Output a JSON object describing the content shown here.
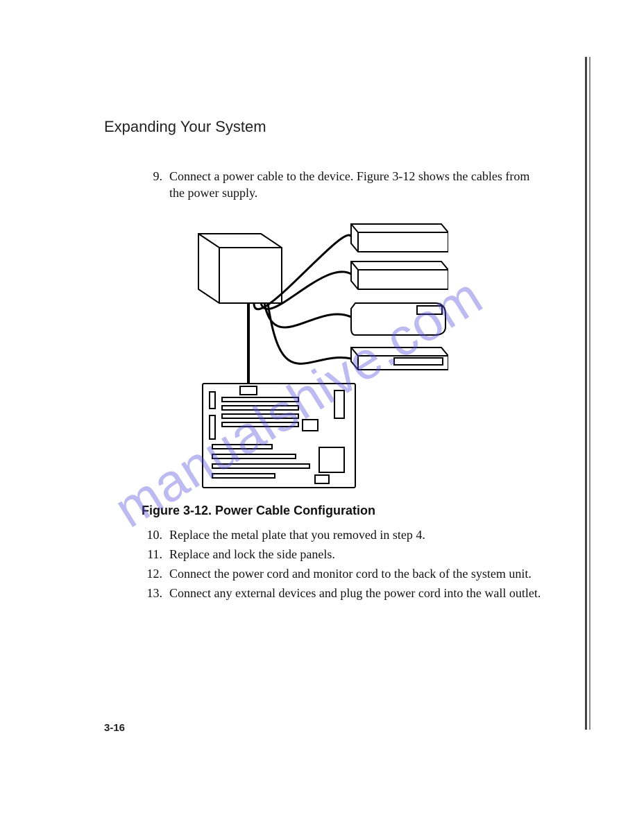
{
  "section_title": "Expanding Your System",
  "steps_top": [
    {
      "num": "9.",
      "text": "Connect a power cable to the device.  Figure 3-12 shows the cables from the power supply."
    }
  ],
  "figure": {
    "caption": "Figure 3-12.  Power Cable Configuration"
  },
  "steps_bottom": [
    {
      "num": "10.",
      "text": "Replace the metal plate that you removed in step 4."
    },
    {
      "num": "11.",
      "text": "Replace and lock the side panels."
    },
    {
      "num": "12.",
      "text": "Connect the power cord and monitor cord to the back of the system unit."
    },
    {
      "num": "13.",
      "text": "Connect any external devices and plug the power cord into the wall outlet."
    }
  ],
  "page_number": "3-16",
  "watermark": "manualshive.com"
}
